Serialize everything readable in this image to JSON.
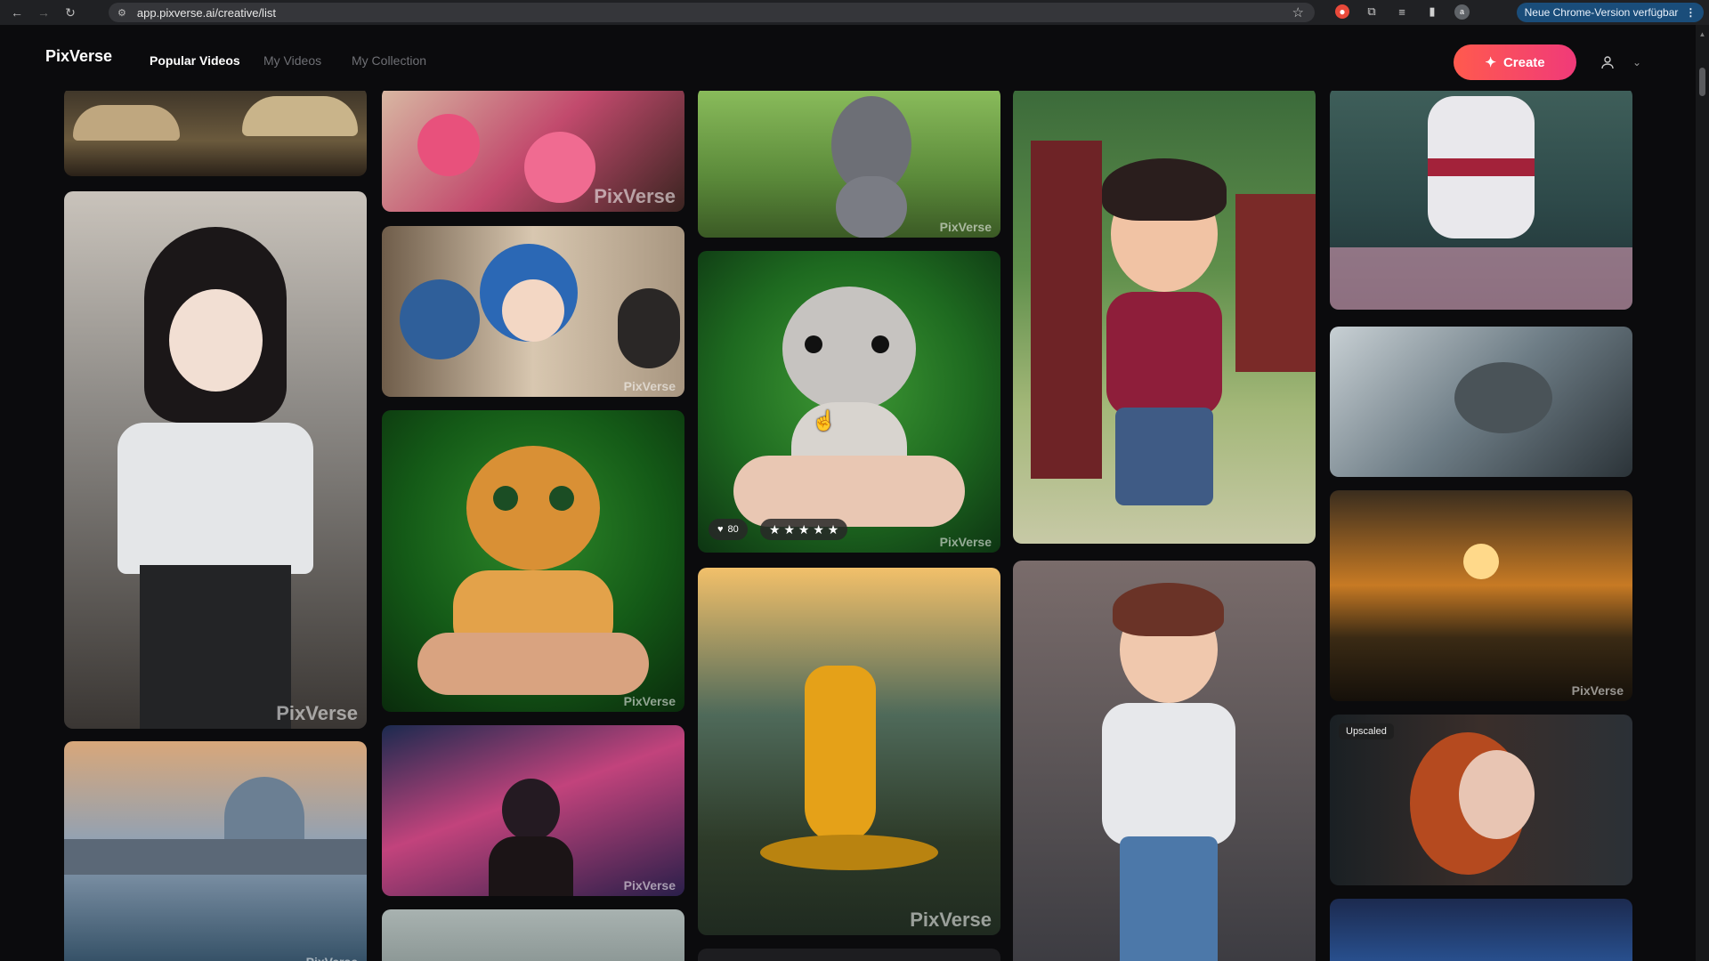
{
  "browser": {
    "url": "app.pixverse.ai/creative/list",
    "update_label": "Neue Chrome-Version verfügbar",
    "ext_initial": "a"
  },
  "app": {
    "logo": "PixVerse",
    "tabs": [
      {
        "label": "Popular Videos"
      },
      {
        "label": "My Videos"
      },
      {
        "label": "My Collection"
      }
    ],
    "create_label": "Create"
  },
  "cards": {
    "watermark": "PixVerse",
    "dog": {
      "likes": "80",
      "stars": "★ ★ ★ ★ ★"
    },
    "upscaled": "Upscaled"
  },
  "colors": {
    "accent_start": "#ff5a4e",
    "accent_end": "#f03a79",
    "background": "#0b0b0d"
  }
}
